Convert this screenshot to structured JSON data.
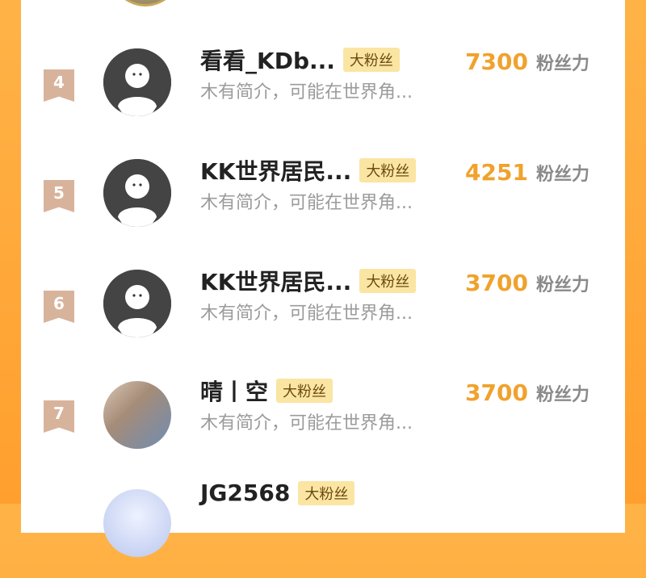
{
  "fans_unit": "粉丝力",
  "rows": [
    {
      "rank": "4",
      "name": "看看_KDb...",
      "badge": "大粉丝",
      "desc": "木有简介，可能在世界角...",
      "count": "7300",
      "avatar": "default-avatar-icon"
    },
    {
      "rank": "5",
      "name": "KK世界居民...",
      "badge": "大粉丝",
      "desc": "木有简介，可能在世界角...",
      "count": "4251",
      "avatar": "default-avatar-icon"
    },
    {
      "rank": "6",
      "name": "KK世界居民...",
      "badge": "大粉丝",
      "desc": "木有简介，可能在世界角...",
      "count": "3700",
      "avatar": "default-avatar-icon"
    },
    {
      "rank": "7",
      "name": "晴丨空",
      "badge": "大粉丝",
      "desc": "木有简介，可能在世界角...",
      "count": "3700",
      "avatar": "photo-avatar"
    }
  ],
  "partial_row": {
    "name": "JG2568",
    "badge": "大粉丝"
  }
}
